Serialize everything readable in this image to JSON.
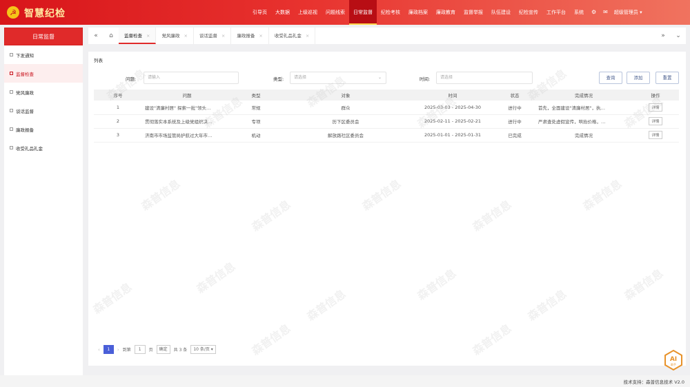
{
  "app": {
    "title": "智慧纪检",
    "emblem": "☭"
  },
  "nav": {
    "items": [
      "引导页",
      "大数据",
      "上级巡视",
      "问题线索",
      "日常监督",
      "纪检考核",
      "廉政档案",
      "廉政教育",
      "监督举报",
      "队伍建设",
      "纪检宣传",
      "工作平台",
      "系统"
    ],
    "active_index": 4,
    "user": "超级管理员 ▾"
  },
  "sidebar": {
    "title": "日常监督",
    "items": [
      "下发通知",
      "监督检查",
      "党风廉政",
      "谈话监督",
      "廉政报备",
      "收受礼品礼金"
    ],
    "active_index": 1
  },
  "tabs": {
    "items": [
      "监督检查",
      "党风廉政",
      "谈话监督",
      "廉政报备",
      "收受礼品礼金"
    ],
    "active_index": 0
  },
  "panel": {
    "title": "列表",
    "filters": {
      "issue_label": "问题:",
      "issue_placeholder": "请输入",
      "type_label": "类型:",
      "type_placeholder": "请选择",
      "time_label": "时间:",
      "time_placeholder": "请选择"
    },
    "buttons": {
      "query": "查询",
      "add": "添加",
      "reset": "重置"
    }
  },
  "table": {
    "headers": [
      "序号",
      "问题",
      "类型",
      "对象",
      "时间",
      "状态",
      "完成情况",
      "操作"
    ],
    "rows": [
      [
        "1",
        "建设\"清廉村居\" 探索一批\"领头…",
        "常规",
        "群众",
        "2025-03-03 - 2025-04-30",
        "进行中",
        "首先，全面建设\"清廉村居\"，执…",
        "详情"
      ],
      [
        "2",
        "贯彻落实本系统及上级党组织决…",
        "专项",
        "历下区委员会",
        "2025-02-11 - 2025-02-21",
        "进行中",
        "严肃查处虚假宣传，哄抬价格，…",
        "详情"
      ],
      [
        "3",
        "济南市市场监管局护航过大年市…",
        "机动",
        "解放路社区委员会",
        "2025-01-01 - 2025-01-31",
        "已完成",
        "完成情况",
        "详情"
      ]
    ]
  },
  "pager": {
    "prev": "‹",
    "current": "1",
    "next": "›",
    "goto_label": "到第",
    "goto_value": "1",
    "page_unit": "页",
    "confirm": "确定",
    "total": "共 3 条",
    "page_size": "10 条/页 ▾"
  },
  "footer": {
    "text": "技术支持：森普信息技术 V2.0"
  },
  "ai_badge": {
    "top": "AI",
    "bottom": "助手"
  },
  "watermark": "森普信息",
  "colors": {
    "brand_red": "#e02a2a",
    "pager_blue": "#4a5fd8",
    "badge_orange": "#e8922a"
  }
}
